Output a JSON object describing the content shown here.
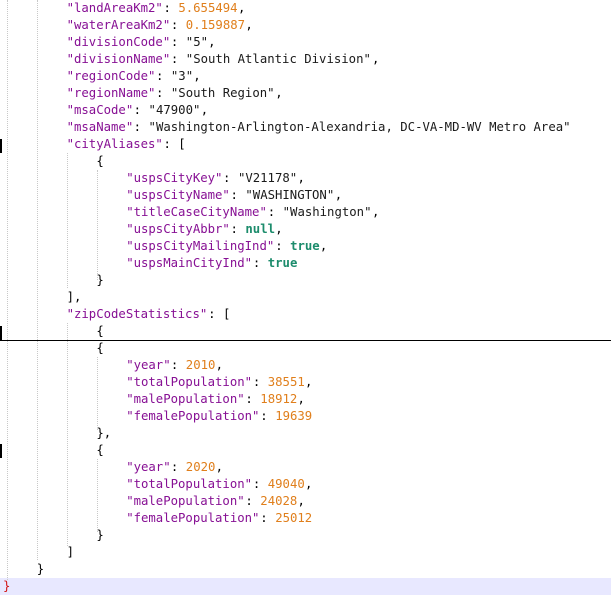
{
  "lines": [
    {
      "indent": 8,
      "tokens": [
        {
          "t": "\"landAreaKm2\"",
          "c": "key"
        },
        {
          "t": ": ",
          "c": "punc"
        },
        {
          "t": "5.655494",
          "c": "num"
        },
        {
          "t": ",",
          "c": "punc"
        }
      ]
    },
    {
      "indent": 8,
      "tokens": [
        {
          "t": "\"waterAreaKm2\"",
          "c": "key"
        },
        {
          "t": ": ",
          "c": "punc"
        },
        {
          "t": "0.159887",
          "c": "num"
        },
        {
          "t": ",",
          "c": "punc"
        }
      ]
    },
    {
      "indent": 8,
      "tokens": [
        {
          "t": "\"divisionCode\"",
          "c": "key"
        },
        {
          "t": ": ",
          "c": "punc"
        },
        {
          "t": "\"5\"",
          "c": "str"
        },
        {
          "t": ",",
          "c": "punc"
        }
      ]
    },
    {
      "indent": 8,
      "tokens": [
        {
          "t": "\"divisionName\"",
          "c": "key"
        },
        {
          "t": ": ",
          "c": "punc"
        },
        {
          "t": "\"South Atlantic Division\"",
          "c": "str"
        },
        {
          "t": ",",
          "c": "punc"
        }
      ]
    },
    {
      "indent": 8,
      "tokens": [
        {
          "t": "\"regionCode\"",
          "c": "key"
        },
        {
          "t": ": ",
          "c": "punc"
        },
        {
          "t": "\"3\"",
          "c": "str"
        },
        {
          "t": ",",
          "c": "punc"
        }
      ]
    },
    {
      "indent": 8,
      "tokens": [
        {
          "t": "\"regionName\"",
          "c": "key"
        },
        {
          "t": ": ",
          "c": "punc"
        },
        {
          "t": "\"South Region\"",
          "c": "str"
        },
        {
          "t": ",",
          "c": "punc"
        }
      ]
    },
    {
      "indent": 8,
      "tokens": [
        {
          "t": "\"msaCode\"",
          "c": "key"
        },
        {
          "t": ": ",
          "c": "punc"
        },
        {
          "t": "\"47900\"",
          "c": "str"
        },
        {
          "t": ",",
          "c": "punc"
        }
      ]
    },
    {
      "indent": 8,
      "tokens": [
        {
          "t": "\"msaName\"",
          "c": "key"
        },
        {
          "t": ": ",
          "c": "punc"
        },
        {
          "t": "\"Washington-Arlington-Alexandria, DC-VA-MD-WV Metro Area\"",
          "c": "str"
        }
      ]
    },
    {
      "indent": 8,
      "tokens": [
        {
          "t": "\"cityAliases\"",
          "c": "key"
        },
        {
          "t": ": [",
          "c": "punc"
        }
      ]
    },
    {
      "indent": 12,
      "tokens": [
        {
          "t": "{",
          "c": "punc"
        }
      ]
    },
    {
      "indent": 16,
      "tokens": [
        {
          "t": "\"uspsCityKey\"",
          "c": "key"
        },
        {
          "t": ": ",
          "c": "punc"
        },
        {
          "t": "\"V21178\"",
          "c": "str"
        },
        {
          "t": ",",
          "c": "punc"
        }
      ]
    },
    {
      "indent": 16,
      "tokens": [
        {
          "t": "\"uspsCityName\"",
          "c": "key"
        },
        {
          "t": ": ",
          "c": "punc"
        },
        {
          "t": "\"WASHINGTON\"",
          "c": "str"
        },
        {
          "t": ",",
          "c": "punc"
        }
      ]
    },
    {
      "indent": 16,
      "tokens": [
        {
          "t": "\"titleCaseCityName\"",
          "c": "key"
        },
        {
          "t": ": ",
          "c": "punc"
        },
        {
          "t": "\"Washington\"",
          "c": "str"
        },
        {
          "t": ",",
          "c": "punc"
        }
      ]
    },
    {
      "indent": 16,
      "tokens": [
        {
          "t": "\"uspsCityAbbr\"",
          "c": "key"
        },
        {
          "t": ": ",
          "c": "punc"
        },
        {
          "t": "null",
          "c": "kw"
        },
        {
          "t": ",",
          "c": "punc"
        }
      ]
    },
    {
      "indent": 16,
      "tokens": [
        {
          "t": "\"uspsCityMailingInd\"",
          "c": "key"
        },
        {
          "t": ": ",
          "c": "punc"
        },
        {
          "t": "true",
          "c": "kw"
        },
        {
          "t": ",",
          "c": "punc"
        }
      ]
    },
    {
      "indent": 16,
      "tokens": [
        {
          "t": "\"uspsMainCityInd\"",
          "c": "key"
        },
        {
          "t": ": ",
          "c": "punc"
        },
        {
          "t": "true",
          "c": "kw"
        }
      ]
    },
    {
      "indent": 12,
      "tokens": [
        {
          "t": "}",
          "c": "punc"
        }
      ]
    },
    {
      "indent": 8,
      "tokens": [
        {
          "t": "],",
          "c": "punc"
        }
      ]
    },
    {
      "indent": 8,
      "tokens": [
        {
          "t": "\"zipCodeStatistics\"",
          "c": "key"
        },
        {
          "t": ": [",
          "c": "punc"
        }
      ]
    },
    {
      "indent": 12,
      "tokens": [
        {
          "t": "{",
          "c": "punc"
        }
      ]
    },
    {
      "indent": 12,
      "tokens": [
        {
          "t": "{",
          "c": "punc"
        }
      ]
    },
    {
      "indent": 16,
      "tokens": [
        {
          "t": "\"year\"",
          "c": "key"
        },
        {
          "t": ": ",
          "c": "punc"
        },
        {
          "t": "2010",
          "c": "num"
        },
        {
          "t": ",",
          "c": "punc"
        }
      ]
    },
    {
      "indent": 16,
      "tokens": [
        {
          "t": "\"totalPopulation\"",
          "c": "key"
        },
        {
          "t": ": ",
          "c": "punc"
        },
        {
          "t": "38551",
          "c": "num"
        },
        {
          "t": ",",
          "c": "punc"
        }
      ]
    },
    {
      "indent": 16,
      "tokens": [
        {
          "t": "\"malePopulation\"",
          "c": "key"
        },
        {
          "t": ": ",
          "c": "punc"
        },
        {
          "t": "18912",
          "c": "num"
        },
        {
          "t": ",",
          "c": "punc"
        }
      ]
    },
    {
      "indent": 16,
      "tokens": [
        {
          "t": "\"femalePopulation\"",
          "c": "key"
        },
        {
          "t": ": ",
          "c": "punc"
        },
        {
          "t": "19639",
          "c": "num"
        }
      ]
    },
    {
      "indent": 12,
      "tokens": [
        {
          "t": "},",
          "c": "punc"
        }
      ]
    },
    {
      "indent": 12,
      "tokens": [
        {
          "t": "{",
          "c": "punc"
        }
      ]
    },
    {
      "indent": 16,
      "tokens": [
        {
          "t": "\"year\"",
          "c": "key"
        },
        {
          "t": ": ",
          "c": "punc"
        },
        {
          "t": "2020",
          "c": "num"
        },
        {
          "t": ",",
          "c": "punc"
        }
      ]
    },
    {
      "indent": 16,
      "tokens": [
        {
          "t": "\"totalPopulation\"",
          "c": "key"
        },
        {
          "t": ": ",
          "c": "punc"
        },
        {
          "t": "49040",
          "c": "num"
        },
        {
          "t": ",",
          "c": "punc"
        }
      ]
    },
    {
      "indent": 16,
      "tokens": [
        {
          "t": "\"malePopulation\"",
          "c": "key"
        },
        {
          "t": ": ",
          "c": "punc"
        },
        {
          "t": "24028",
          "c": "num"
        },
        {
          "t": ",",
          "c": "punc"
        }
      ]
    },
    {
      "indent": 16,
      "tokens": [
        {
          "t": "\"femalePopulation\"",
          "c": "key"
        },
        {
          "t": ": ",
          "c": "punc"
        },
        {
          "t": "25012",
          "c": "num"
        }
      ]
    },
    {
      "indent": 12,
      "tokens": [
        {
          "t": "}",
          "c": "punc"
        }
      ]
    },
    {
      "indent": 8,
      "tokens": [
        {
          "t": "]",
          "c": "punc"
        }
      ]
    },
    {
      "indent": 4,
      "tokens": [
        {
          "t": "}",
          "c": "punc"
        }
      ]
    },
    {
      "indent": 0,
      "tokens": [
        {
          "t": "}",
          "c": "brace-red"
        }
      ],
      "current": true
    }
  ],
  "colors": {
    "key": "#871094",
    "string": "#1a1a1a",
    "number": "#e07f1c",
    "keyword": "#1c8c6c",
    "current_line": "#e8e8ff"
  }
}
